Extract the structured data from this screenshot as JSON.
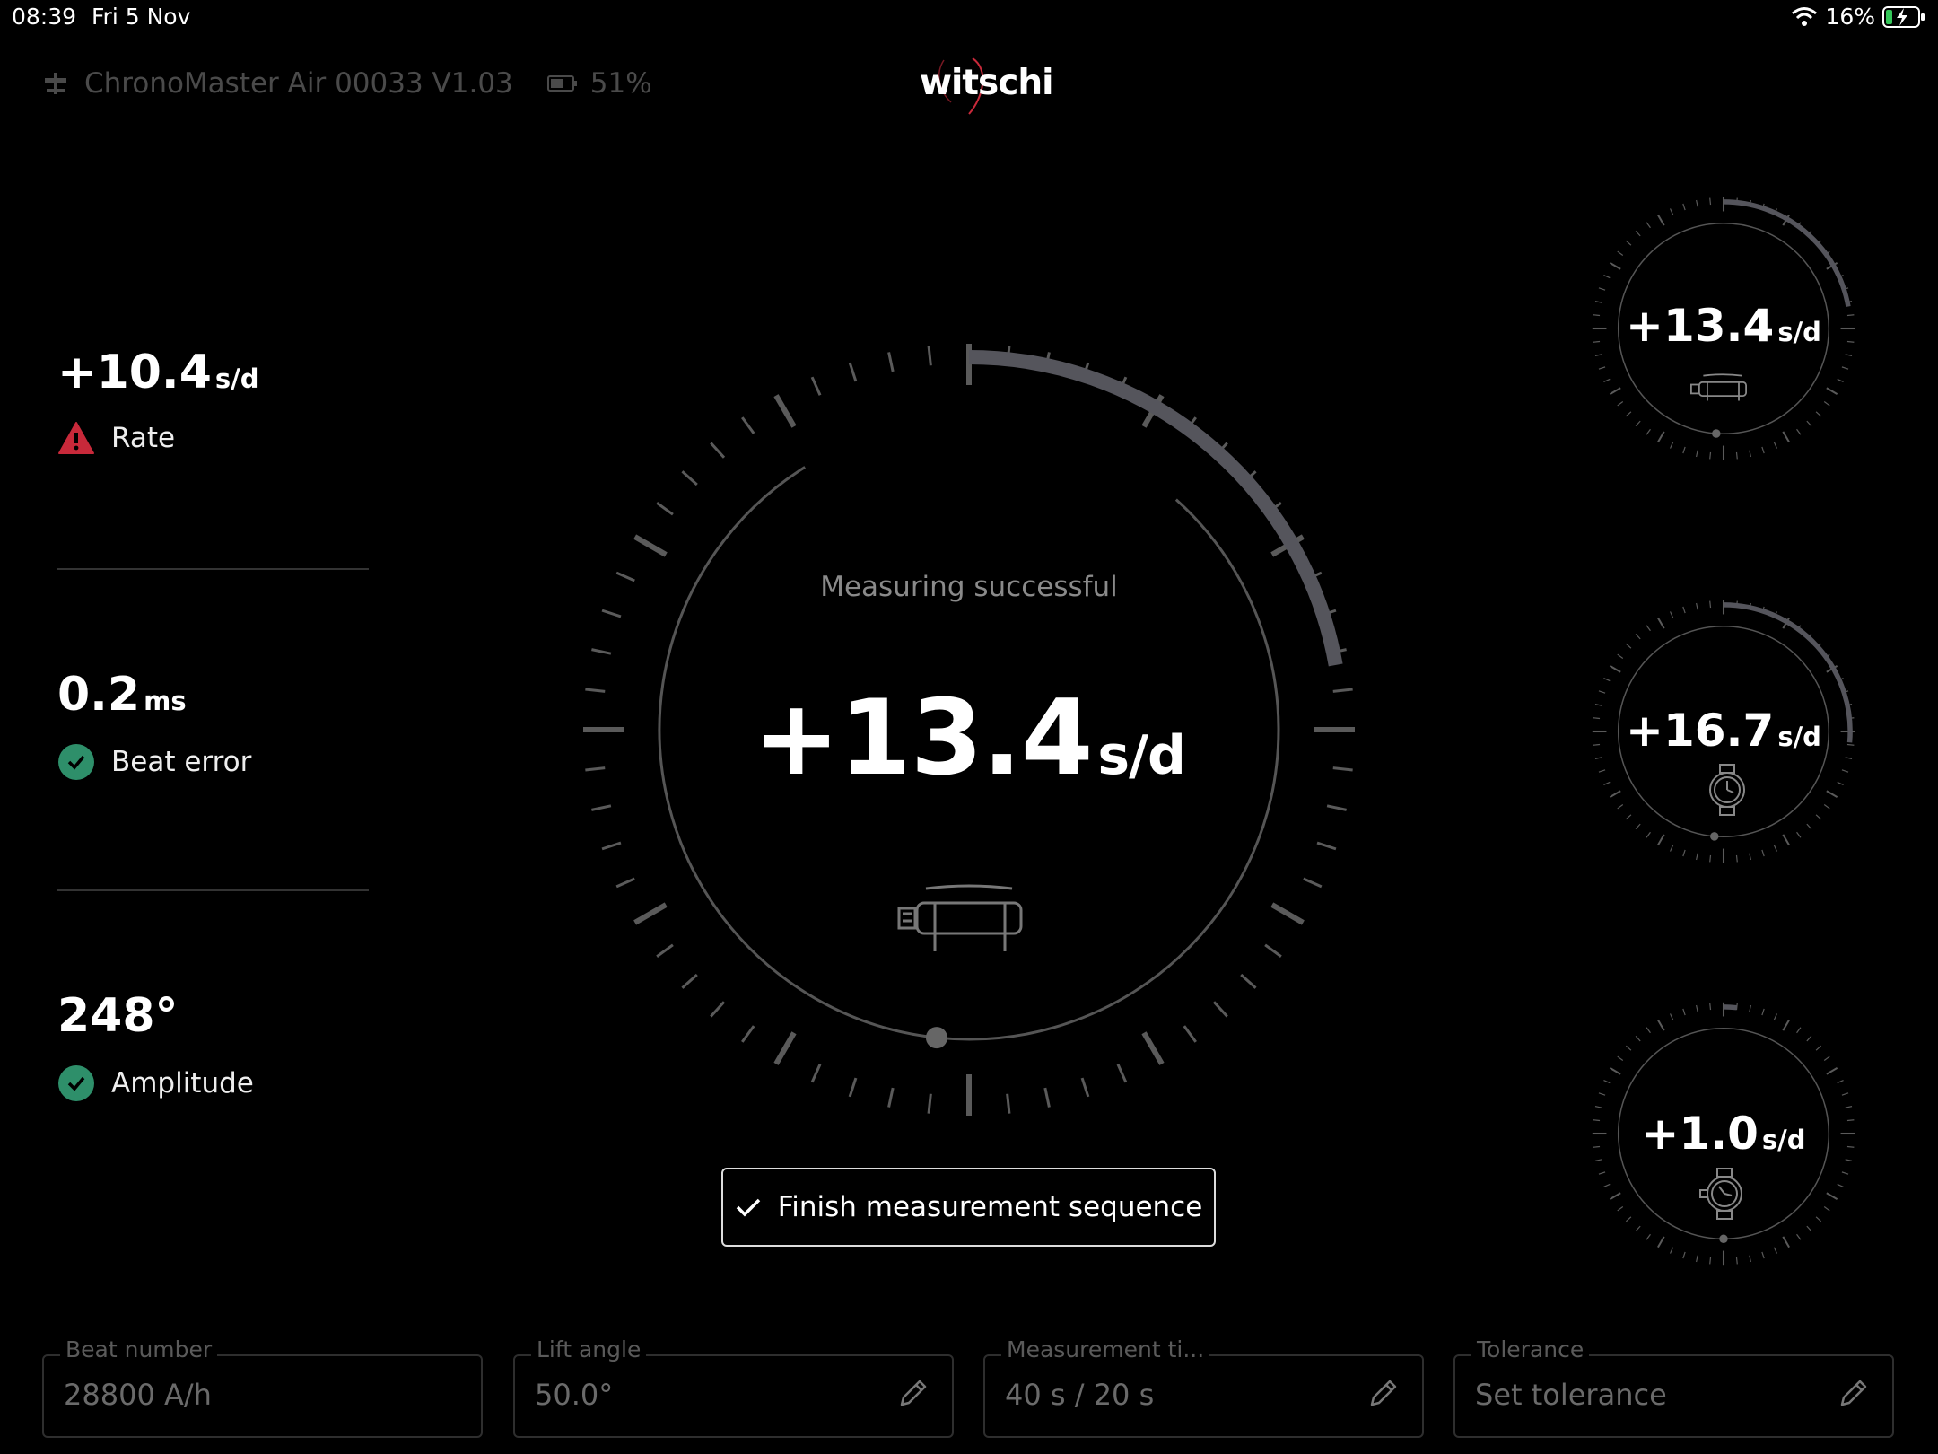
{
  "status_bar": {
    "time": "08:39",
    "date": "Fri 5 Nov",
    "battery_percent": "16%"
  },
  "header": {
    "device_name": "ChronoMaster Air 00033 V1.03",
    "device_battery": "51%",
    "logo_text": "witschi"
  },
  "metrics": [
    {
      "value": "+10.4",
      "unit": "s/d",
      "label": "Rate",
      "status": "warning"
    },
    {
      "value": "0.2",
      "unit": "ms",
      "label": "Beat error",
      "status": "ok"
    },
    {
      "value": "248°",
      "unit": "",
      "label": "Amplitude",
      "status": "ok"
    }
  ],
  "main_gauge": {
    "status_text": "Measuring successful",
    "value": "+13.4",
    "unit": "s/d",
    "position_icon": "dial-up-watch-icon"
  },
  "positions": [
    {
      "value": "+13.4",
      "unit": "s/d",
      "icon": "dial-up-watch-icon"
    },
    {
      "value": "+16.7",
      "unit": "s/d",
      "icon": "crown-down-watch-icon"
    },
    {
      "value": "+1.0",
      "unit": "s/d",
      "icon": "crown-left-watch-icon"
    }
  ],
  "finish_button": {
    "label": "Finish measurement sequence"
  },
  "fields": [
    {
      "label": "Beat number",
      "value": "28800 A/h",
      "editable": false
    },
    {
      "label": "Lift angle",
      "value": "50.0°",
      "editable": true
    },
    {
      "label": "Measurement ti...",
      "value": "40 s / 20 s",
      "editable": true
    },
    {
      "label": "Tolerance",
      "value": "Set tolerance",
      "editable": true
    }
  ],
  "colors": {
    "warning": "#c8293a",
    "ok": "#2e8f6a",
    "arc": "#55555c"
  }
}
